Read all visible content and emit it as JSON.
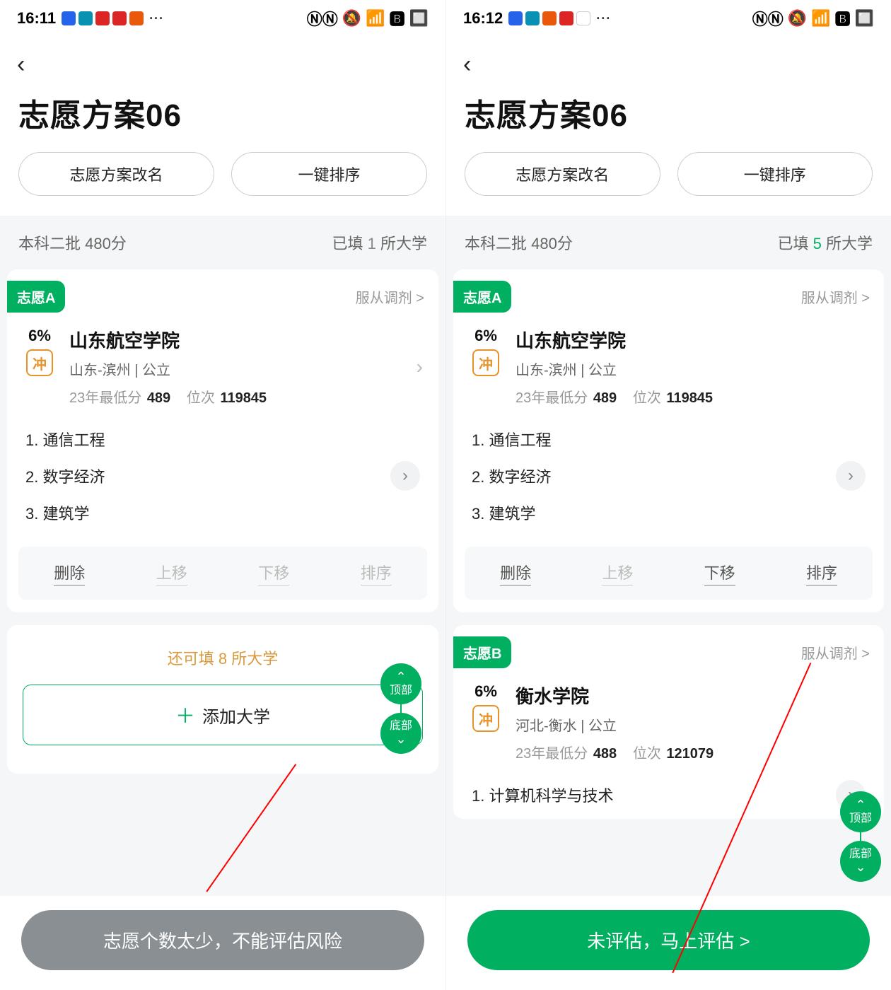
{
  "left": {
    "status": {
      "time": "16:11",
      "dots": "···"
    },
    "title": "志愿方案06",
    "buttons": {
      "rename": "志愿方案改名",
      "sort": "一键排序"
    },
    "batch": {
      "left": "本科二批 480分",
      "prefix": "已填 ",
      "count": "1",
      "suffix": " 所大学"
    },
    "cardA": {
      "chip": "志愿A",
      "adjust": "服从调剂 >",
      "pct": "6%",
      "badge": "冲",
      "school": "山东航空学院",
      "sub": "山东-滨州 | 公立",
      "score_label": "23年最低分",
      "score": "489",
      "rank_label": "位次",
      "rank": "119845",
      "majors": [
        "1. 通信工程",
        "2. 数字经济",
        "3. 建筑学"
      ],
      "actions": {
        "delete": "删除",
        "up": "上移",
        "down": "下移",
        "sort": "排序"
      }
    },
    "add": {
      "hint": "还可填 8 所大学",
      "label": "添加大学"
    },
    "fab": {
      "top": "顶部",
      "bottom": "底部"
    },
    "bottom": "志愿个数太少，不能评估风险"
  },
  "right": {
    "status": {
      "time": "16:12",
      "dots": "···"
    },
    "title": "志愿方案06",
    "buttons": {
      "rename": "志愿方案改名",
      "sort": "一键排序"
    },
    "batch": {
      "left": "本科二批 480分",
      "prefix": "已填 ",
      "count": "5",
      "suffix": " 所大学"
    },
    "cardA": {
      "chip": "志愿A",
      "adjust": "服从调剂 >",
      "pct": "6%",
      "badge": "冲",
      "school": "山东航空学院",
      "sub": "山东-滨州 | 公立",
      "score_label": "23年最低分",
      "score": "489",
      "rank_label": "位次",
      "rank": "119845",
      "majors": [
        "1. 通信工程",
        "2. 数字经济",
        "3. 建筑学"
      ],
      "actions": {
        "delete": "删除",
        "up": "上移",
        "down": "下移",
        "sort": "排序"
      }
    },
    "cardB": {
      "chip": "志愿B",
      "adjust": "服从调剂 >",
      "pct": "6%",
      "badge": "冲",
      "school": "衡水学院",
      "sub": "河北-衡水 | 公立",
      "score_label": "23年最低分",
      "score": "488",
      "rank_label": "位次",
      "rank": "121079",
      "majors": [
        "1. 计算机科学与技术"
      ]
    },
    "fab": {
      "top": "顶部",
      "bottom": "底部"
    },
    "bottom": "未评估，马上评估 >"
  }
}
